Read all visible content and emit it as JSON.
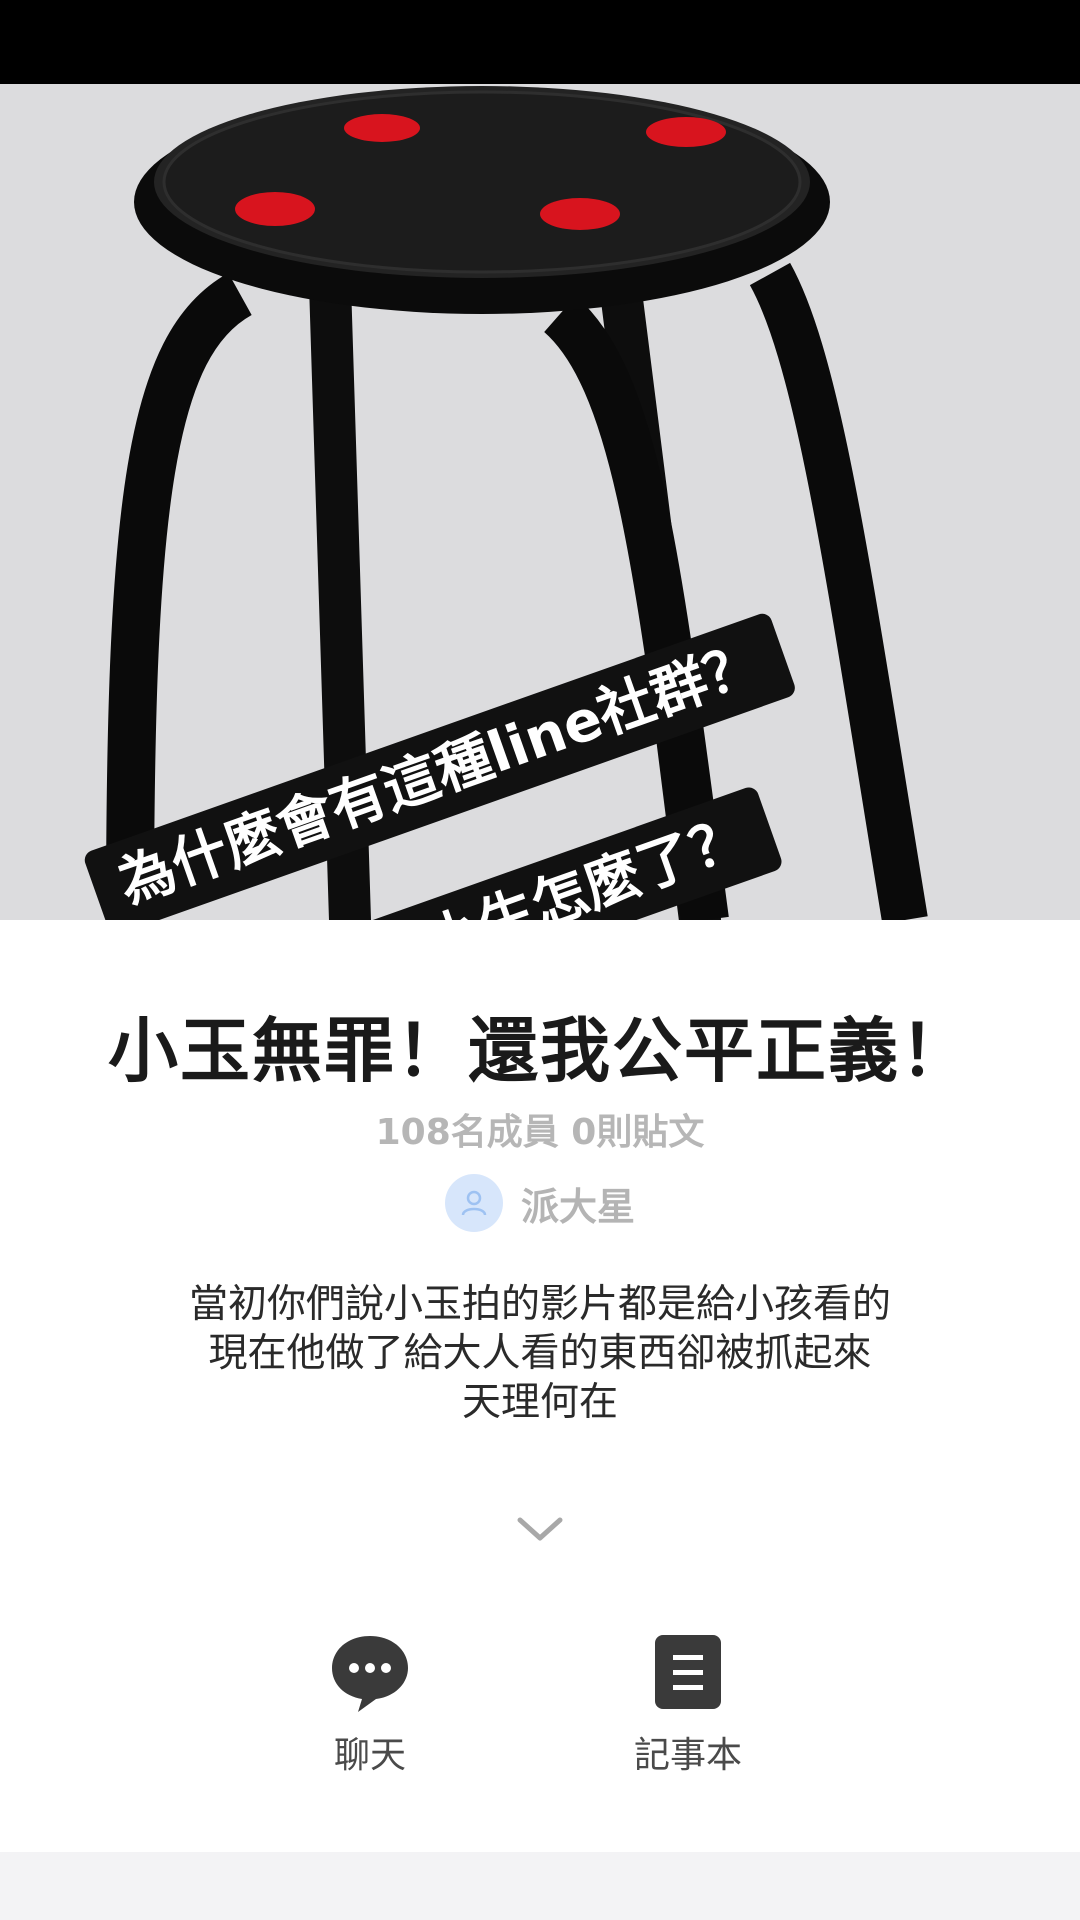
{
  "cover": {
    "overlay_texts": [
      "為什麼會有這種line社群？",
      "現在的國小生怎麼了？"
    ]
  },
  "group": {
    "title": "小玉無罪！還我公平正義！",
    "meta": "108名成員 0則貼文",
    "creator_name": "派大星",
    "description_lines": [
      "當初你們說小玉拍的影片都是給小孩看的",
      "現在他做了給大人看的東西卻被抓起來",
      "天理何在"
    ]
  },
  "actions": {
    "chat_label": "聊天",
    "notes_label": "記事本"
  },
  "colors": {
    "cover_bg": "#dcdcde",
    "stool": "#0e0e0e",
    "stool_dots": "#d8141e",
    "avatar_bg": "#d7e6fb",
    "icon_dark": "#3a3a3a"
  },
  "icons": {
    "chat": "chat-bubble-icon",
    "notes": "notebook-icon",
    "avatar": "default-user-icon",
    "expand": "chevron-down-icon"
  }
}
